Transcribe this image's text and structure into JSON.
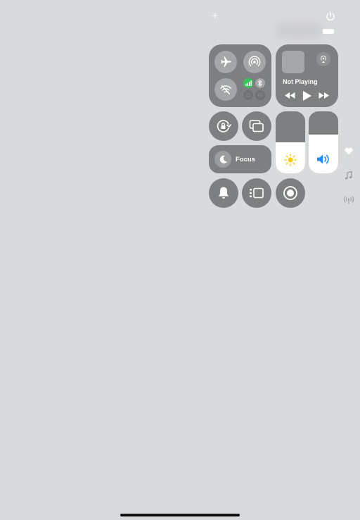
{
  "header": {
    "add_glyph": "+",
    "power_glyph": "⏻"
  },
  "connectivity": {
    "airplane": "airplane-icon",
    "airdrop": "airdrop-icon",
    "wifi": "wifi-off-icon",
    "cellular": "cellular-icon",
    "bluetooth": "bluetooth-icon"
  },
  "now_playing": {
    "label": "Not Playing"
  },
  "focus": {
    "label": "Focus"
  },
  "brightness": {
    "level": 0.5
  },
  "volume": {
    "level": 0.62
  },
  "colors": {
    "module": "#7e7f81",
    "background": "#d9dadc",
    "cellular_active": "#32c759",
    "volume_icon": "#1a8dff",
    "brightness_icon": "#ffcc00"
  }
}
